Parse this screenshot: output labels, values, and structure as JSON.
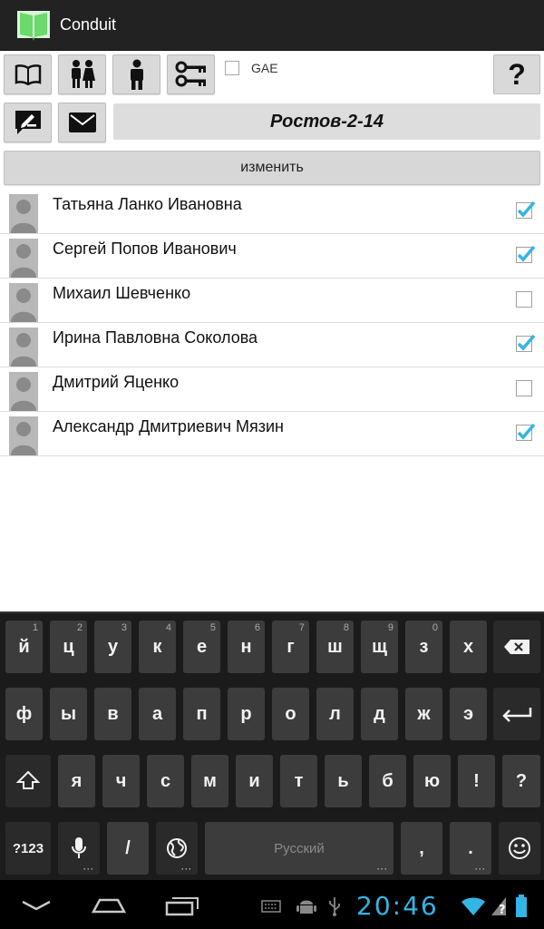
{
  "app": {
    "title": "Conduit"
  },
  "toolbar": {
    "gae_label": "GAE",
    "help_label": "?"
  },
  "group": {
    "title": "Ростов-2-14"
  },
  "change_button": {
    "label": "изменить"
  },
  "members": [
    {
      "name": "Татьяна Ланко Ивановна",
      "checked": true
    },
    {
      "name": "Сергей Попов Иванович",
      "checked": true
    },
    {
      "name": "Михаил Шевченко",
      "checked": false
    },
    {
      "name": "Ирина Павловна Соколова",
      "checked": true
    },
    {
      "name": "Дмитрий Яценко",
      "checked": false
    },
    {
      "name": "Александр Дмитриевич Мязин",
      "checked": true
    }
  ],
  "keyboard": {
    "row1": [
      {
        "label": "й",
        "hint": "1"
      },
      {
        "label": "ц",
        "hint": "2"
      },
      {
        "label": "у",
        "hint": "3"
      },
      {
        "label": "к",
        "hint": "4"
      },
      {
        "label": "е",
        "hint": "5"
      },
      {
        "label": "н",
        "hint": "6"
      },
      {
        "label": "г",
        "hint": "7"
      },
      {
        "label": "ш",
        "hint": "8"
      },
      {
        "label": "щ",
        "hint": "9"
      },
      {
        "label": "з",
        "hint": "0"
      },
      {
        "label": "х",
        "hint": ""
      }
    ],
    "row2": [
      "ф",
      "ы",
      "в",
      "а",
      "п",
      "р",
      "о",
      "л",
      "д",
      "ж",
      "э"
    ],
    "row3": [
      "я",
      "ч",
      "с",
      "м",
      "и",
      "т",
      "ь",
      "б",
      "ю",
      "!",
      "?"
    ],
    "symbols_label": "?123",
    "slash_label": "/",
    "space_label": "Русский",
    "comma_label": ",",
    "period_label": "."
  },
  "status": {
    "time": "20:46"
  },
  "colors": {
    "accent": "#33b5e5",
    "check": "#33b5e5"
  }
}
